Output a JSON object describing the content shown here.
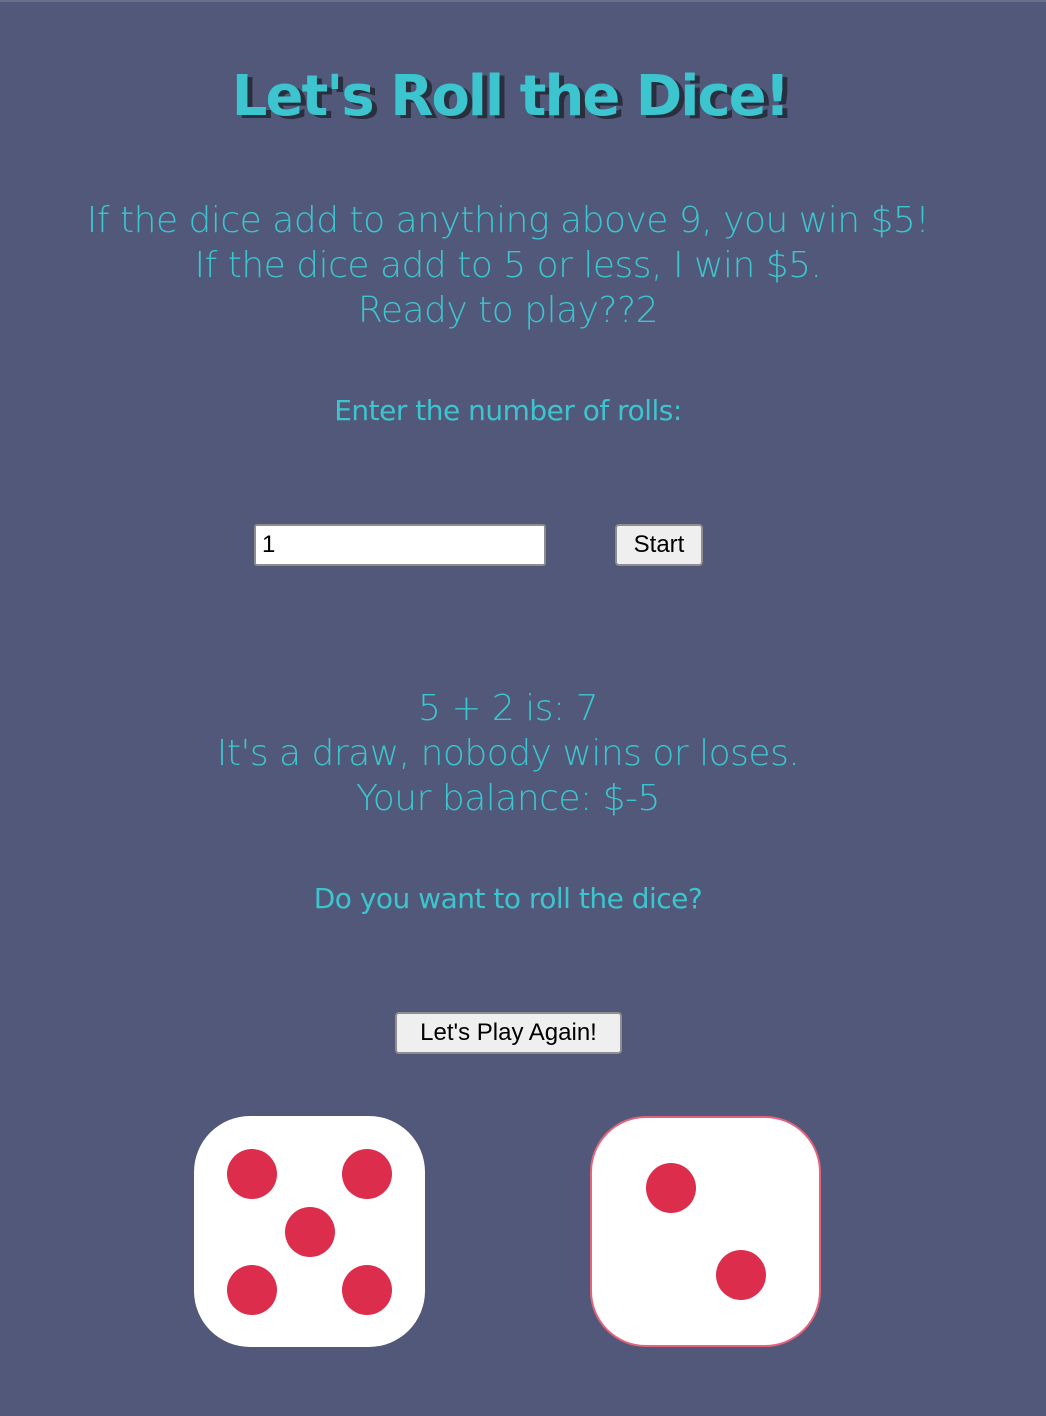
{
  "title": "Let's Roll the Dice!",
  "rules": [
    "If the dice add to anything above 9, you win $5!",
    "If the dice add to 5 or less, I win $5.",
    "Ready to play??2"
  ],
  "rolls_prompt": "Enter the number of rolls:",
  "rolls_input": {
    "value": "1",
    "placeholder": ""
  },
  "start_button": "Start",
  "result": {
    "sum_line": "5 + 2 is: 7",
    "outcome_line": "It's a draw, nobody wins or loses.",
    "balance_line": "Your balance: $-5"
  },
  "again_prompt": "Do you want to roll the dice?",
  "again_button": "Let's Play Again!",
  "dice": [
    {
      "face": 5
    },
    {
      "face": 2
    }
  ],
  "colors": {
    "background": "#525879",
    "accent_text": "#3cc5cf",
    "pip": "#dc2d4c",
    "die_face": "#ffffff"
  }
}
